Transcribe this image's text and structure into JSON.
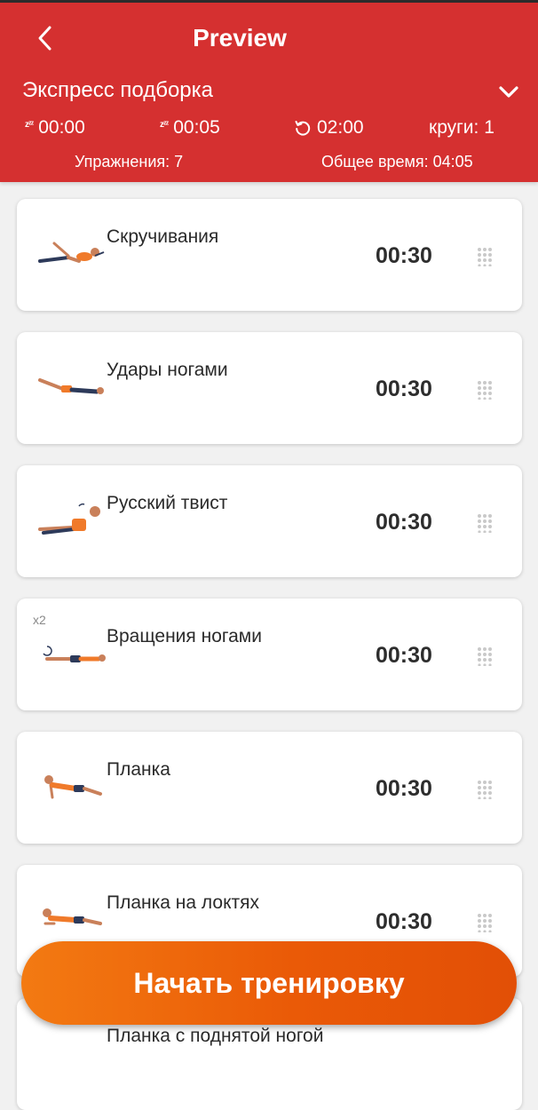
{
  "header": {
    "title": "Preview",
    "workout_name": "Экспресс подборка",
    "rest_exercise": "00:00",
    "rest_set": "00:05",
    "set_rest": "02:00",
    "rounds": "круги: 1",
    "exercises_count": "Упражнения: 7",
    "total_time": "Общее время: 04:05",
    "zz_glyph": "zᶻᶻ",
    "icons": {
      "back": "back-arrow-icon",
      "chevron": "chevron-down-icon",
      "rest": "sleep-zz-icon",
      "repeat": "repeat-icon"
    },
    "colors": {
      "header_bg": "#d53030",
      "accent": "#ea5a07"
    }
  },
  "exercises": [
    {
      "name": "Скручивания",
      "time": "00:30",
      "repeat": ""
    },
    {
      "name": "Удары ногами",
      "time": "00:30",
      "repeat": ""
    },
    {
      "name": "Русский твист",
      "time": "00:30",
      "repeat": ""
    },
    {
      "name": "Вращения ногами",
      "time": "00:30",
      "repeat": "x2"
    },
    {
      "name": "Планка",
      "time": "00:30",
      "repeat": ""
    },
    {
      "name": "Планка на локтях",
      "time": "00:30",
      "repeat": ""
    },
    {
      "name": "Планка с поднятой ногой",
      "time": "",
      "repeat": ""
    }
  ],
  "start_button": {
    "label": "Начать тренировку"
  }
}
